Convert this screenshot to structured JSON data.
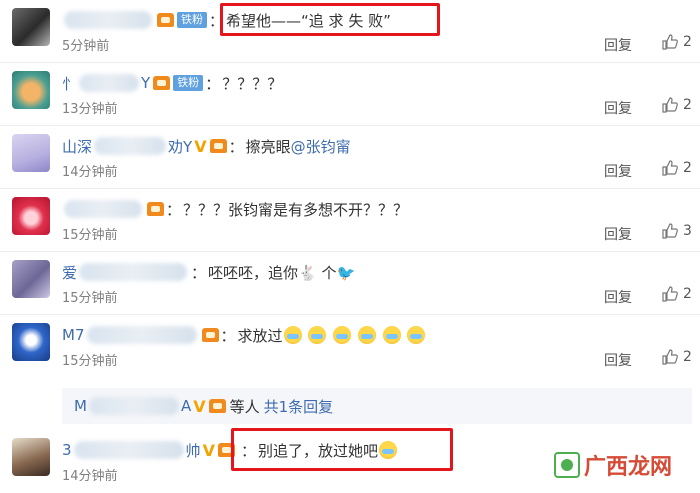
{
  "comments": [
    {
      "name_prefix": "",
      "name_suffix": "",
      "show_v": false,
      "show_fan": true,
      "text": "希望他——“追 求 失 败”",
      "mention": "",
      "emoji_count": 0,
      "time": "5分钟前",
      "reply": "回复",
      "likes": "2"
    },
    {
      "name_prefix": "忄",
      "name_suffix": "Y",
      "show_v": false,
      "show_fan": true,
      "text": "？？？？",
      "mention": "",
      "emoji_count": 0,
      "time": "13分钟前",
      "reply": "回复",
      "likes": "2"
    },
    {
      "name_prefix": "山深",
      "name_suffix": "劝Y",
      "show_v": true,
      "show_fan": false,
      "text": "擦亮眼",
      "mention": "@张钧甯",
      "emoji_count": 0,
      "time": "14分钟前",
      "reply": "回复",
      "likes": "2"
    },
    {
      "name_prefix": "",
      "name_suffix": "",
      "show_v": false,
      "show_fan": false,
      "text": "？？？张钧甯是有多想不开？？？",
      "mention": "",
      "emoji_count": 0,
      "time": "15分钟前",
      "reply": "回复",
      "likes": "3"
    },
    {
      "name_prefix": "爱",
      "name_suffix": "",
      "show_v": false,
      "show_fan": false,
      "text": "呸呸呸，追你🐇 个🐦",
      "mention": "",
      "emoji_count": 0,
      "time": "15分钟前",
      "reply": "回复",
      "likes": "2"
    },
    {
      "name_prefix": "M7",
      "name_suffix": "",
      "show_v": false,
      "show_fan": false,
      "text": "求放过",
      "mention": "",
      "emoji_count": 6,
      "time": "15分钟前",
      "reply": "回复",
      "likes": "2"
    },
    {
      "name_prefix": "3",
      "name_suffix": "帅",
      "show_v": true,
      "show_fan": false,
      "text": "别追了，放过她吧",
      "mention": "",
      "emoji_count": 1,
      "time": "14分钟前",
      "reply": "回复",
      "likes": ""
    }
  ],
  "subreply": {
    "name_prefix": "M",
    "name_suffix": "A",
    "text": "等人",
    "link": "共1条回复"
  },
  "fan_badge": "铁粉",
  "colon": "：",
  "watermark": "广西龙网",
  "colors": {
    "username": "#3f6bb0",
    "highlight_box": "#e4151c",
    "fan_badge": "#5fa0df",
    "v_badge": "#f3a300"
  },
  "icons": {
    "like": "thumbs-up-icon",
    "vip": "vip-crown-icon"
  }
}
